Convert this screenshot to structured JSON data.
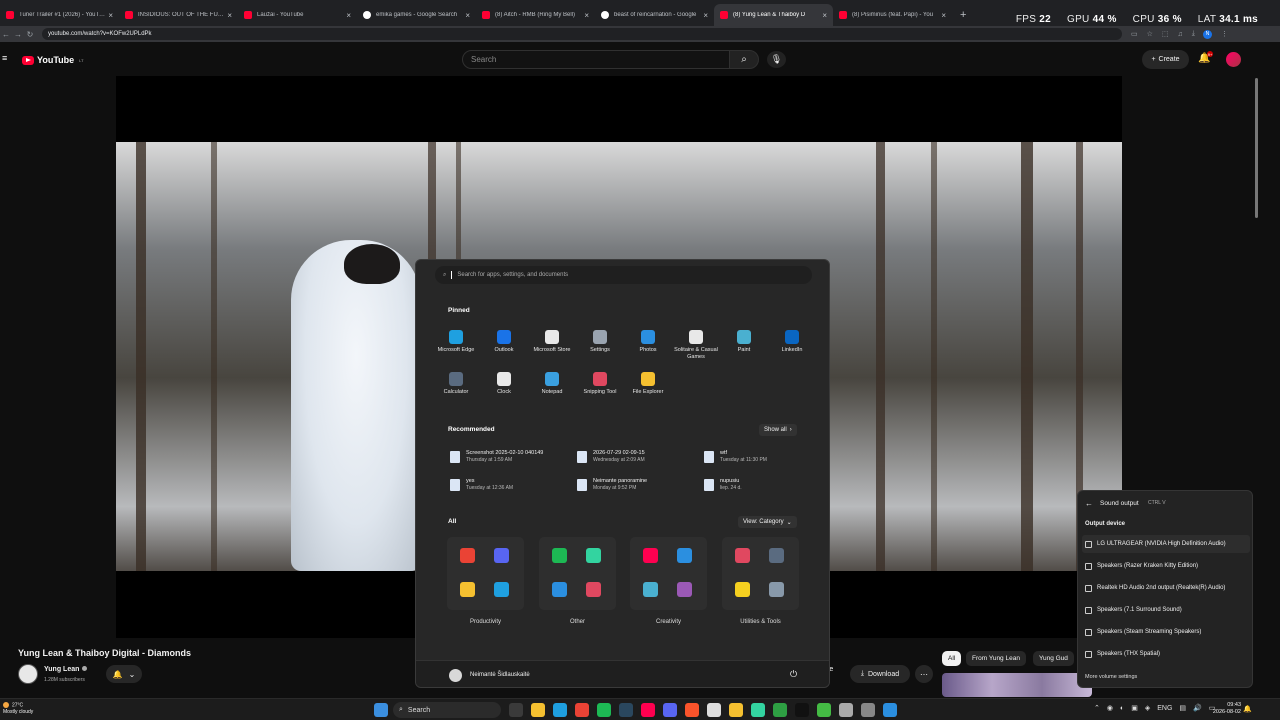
{
  "browser": {
    "tabs": [
      {
        "title": "Tuner Trailer #1 (2026) - YouTube",
        "favicon": "youtube-icon"
      },
      {
        "title": "INSIDIOUS: OUT OF THE FURTHER",
        "favicon": "youtube-icon"
      },
      {
        "title": "Laužai - YouTube",
        "favicon": "youtube-icon"
      },
      {
        "title": "emika games - Google Search",
        "favicon": "google-icon"
      },
      {
        "title": "(8) Aitch - RMB (Ring My Bell)",
        "favicon": "youtube-icon"
      },
      {
        "title": "beast of reincarnation - Google",
        "favicon": "google-icon"
      },
      {
        "title": "(8) Yung Lean & Thaiboy D",
        "favicon": "youtube-icon",
        "active": true
      },
      {
        "title": "(8) Pisiminus (feat. Papi) - You",
        "favicon": "youtube-icon"
      }
    ],
    "url": "youtube.com/watch?v=KOFw2UPLdPk"
  },
  "hud": {
    "fps_label": "FPS",
    "fps": "22",
    "gpu_label": "GPU",
    "gpu": "44 %",
    "cpu_label": "CPU",
    "cpu": "36 %",
    "lat_label": "LAT",
    "lat": "34.1 ms"
  },
  "youtube": {
    "logo": "YouTube",
    "logo_region": "LT",
    "search_placeholder": "Search",
    "create_label": "Create",
    "notif_count": "9+",
    "video_title": "Yung Lean & Thaiboy Digital - Diamonds",
    "channel_name": "Yung Lean",
    "subscribers": "1.28M subscribers",
    "save_label": "ave",
    "download_label": "Download",
    "chips": [
      "All",
      "From Yung Lean",
      "Yung Gud"
    ]
  },
  "start_menu": {
    "search_placeholder": "Search for apps, settings, and documents",
    "pinned_title": "Pinned",
    "pinned": [
      {
        "label": "Microsoft Edge",
        "icon": "edge-icon",
        "color": "#1fa0e0"
      },
      {
        "label": "Outlook",
        "icon": "outlook-icon",
        "color": "#1a73e8"
      },
      {
        "label": "Microsoft Store",
        "icon": "store-icon",
        "color": "#e8e8e8"
      },
      {
        "label": "Settings",
        "icon": "gear-icon",
        "color": "#9aa4b0"
      },
      {
        "label": "Photos",
        "icon": "photos-icon",
        "color": "#2b8fe0"
      },
      {
        "label": "Solitaire & Casual Games",
        "icon": "solitaire-icon",
        "color": "#e8e8e8"
      },
      {
        "label": "Paint",
        "icon": "paint-icon",
        "color": "#4ab0d0"
      },
      {
        "label": "LinkedIn",
        "icon": "linkedin-icon",
        "color": "#0a66c2"
      },
      {
        "label": "Calculator",
        "icon": "calculator-icon",
        "color": "#5a6b80"
      },
      {
        "label": "Clock",
        "icon": "clock-icon",
        "color": "#e8e8e8"
      },
      {
        "label": "Notepad",
        "icon": "notepad-icon",
        "color": "#3aa0e0"
      },
      {
        "label": "Snipping Tool",
        "icon": "snipping-icon",
        "color": "#e04860"
      },
      {
        "label": "File Explorer",
        "icon": "folder-icon",
        "color": "#f5c030"
      }
    ],
    "recommended_title": "Recommended",
    "show_all": "Show all",
    "recommended": [
      {
        "name": "Screenshot 2025-02-10 040149",
        "time": "Thursday at 1:59 AM"
      },
      {
        "name": "2026-07-29 02-09-15",
        "time": "Wednesday at 2:09 AM"
      },
      {
        "name": "wtf",
        "time": "Tuesday at 11:30 PM"
      },
      {
        "name": "yes",
        "time": "Tuesday at 12:36 AM"
      },
      {
        "name": "Neimante panoramine",
        "time": "Monday at 9:52 PM"
      },
      {
        "name": "nupusiu",
        "time": "liep. 24 d."
      }
    ],
    "all_title": "All",
    "view_label": "View: Category",
    "categories": [
      "Productivity",
      "Other",
      "Creativity",
      "Utilities & Tools"
    ],
    "user_name": "Neimantė Šidlauskaitė"
  },
  "sound_panel": {
    "title": "Sound output",
    "shortcut": "CTRL  V",
    "section": "Output device",
    "devices": [
      {
        "name": "LG ULTRAGEAR (NVIDIA High Definition Audio)",
        "selected": true
      },
      {
        "name": "Speakers (Razer Kraken Kitty Edition)"
      },
      {
        "name": "Realtek HD Audio 2nd output (Realtek(R) Audio)"
      },
      {
        "name": "Speakers (7.1 Surround Sound)"
      },
      {
        "name": "Speakers (Steam Streaming Speakers)"
      },
      {
        "name": "Speakers (THX Spatial)"
      }
    ],
    "more": "More volume settings"
  },
  "taskbar": {
    "weather_temp": "27°C",
    "weather_desc": "Mostly cloudy",
    "search_label": "Search",
    "lang": "ENG",
    "time": "09:43",
    "date": "2026-08-02"
  }
}
